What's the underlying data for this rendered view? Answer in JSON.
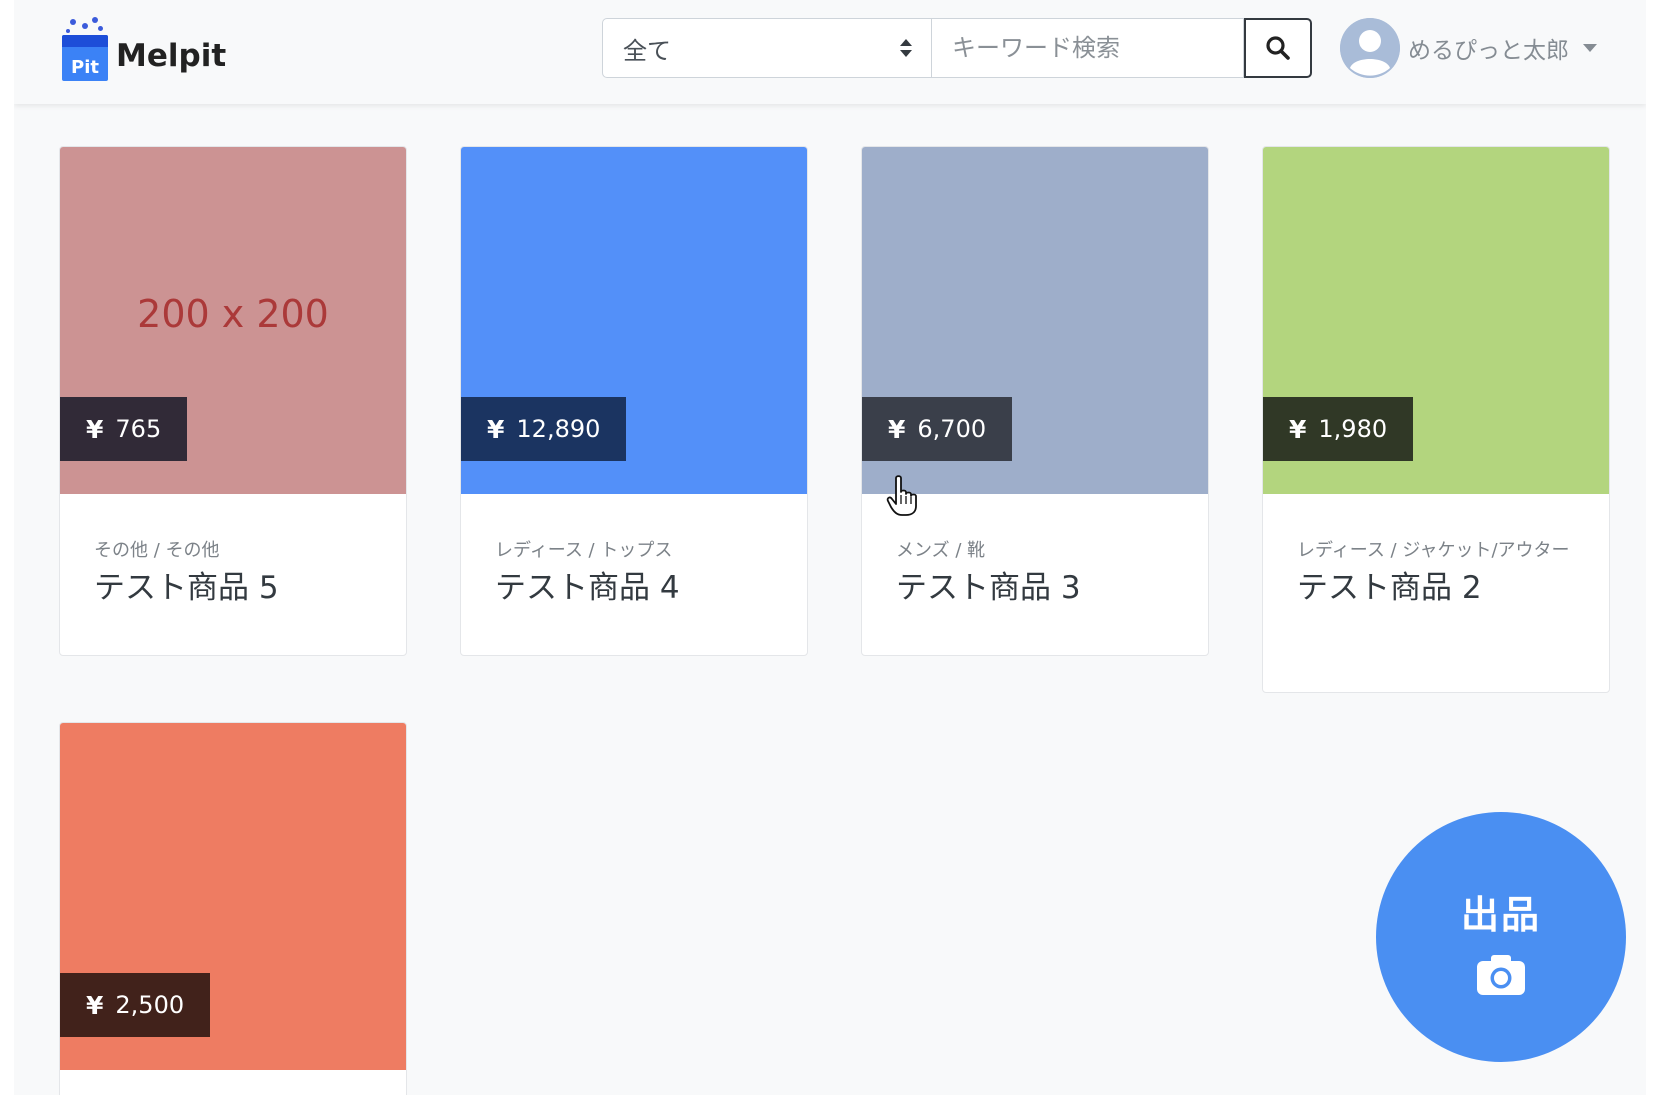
{
  "header": {
    "brand_name": "Melpit",
    "logo_text": "Pit",
    "category_select": {
      "value": "全て"
    },
    "search": {
      "placeholder": "キーワード検索"
    },
    "user": {
      "name": "めるぴっと太郎"
    }
  },
  "items": [
    {
      "image_caption": "200 x 200",
      "image_color": "#cc9393",
      "currency": "¥",
      "price": "765",
      "category": "その他 / その他",
      "name": "テスト商品 5"
    },
    {
      "image_caption": "",
      "image_color": "#5390f9",
      "currency": "¥",
      "price": "12,890",
      "category": "レディース / トップス",
      "name": "テスト商品 4"
    },
    {
      "image_caption": "",
      "image_color": "#9eaeca",
      "currency": "¥",
      "price": "6,700",
      "category": "メンズ / 靴",
      "name": "テスト商品 3"
    },
    {
      "image_caption": "",
      "image_color": "#b3d57e",
      "currency": "¥",
      "price": "1,980",
      "category": "レディース / ジャケット/アウター",
      "name": "テスト商品 2"
    },
    {
      "image_caption": "",
      "image_color": "#ee7c62",
      "currency": "¥",
      "price": "2,500",
      "category": "",
      "name": ""
    }
  ],
  "fab": {
    "label": "出品"
  }
}
